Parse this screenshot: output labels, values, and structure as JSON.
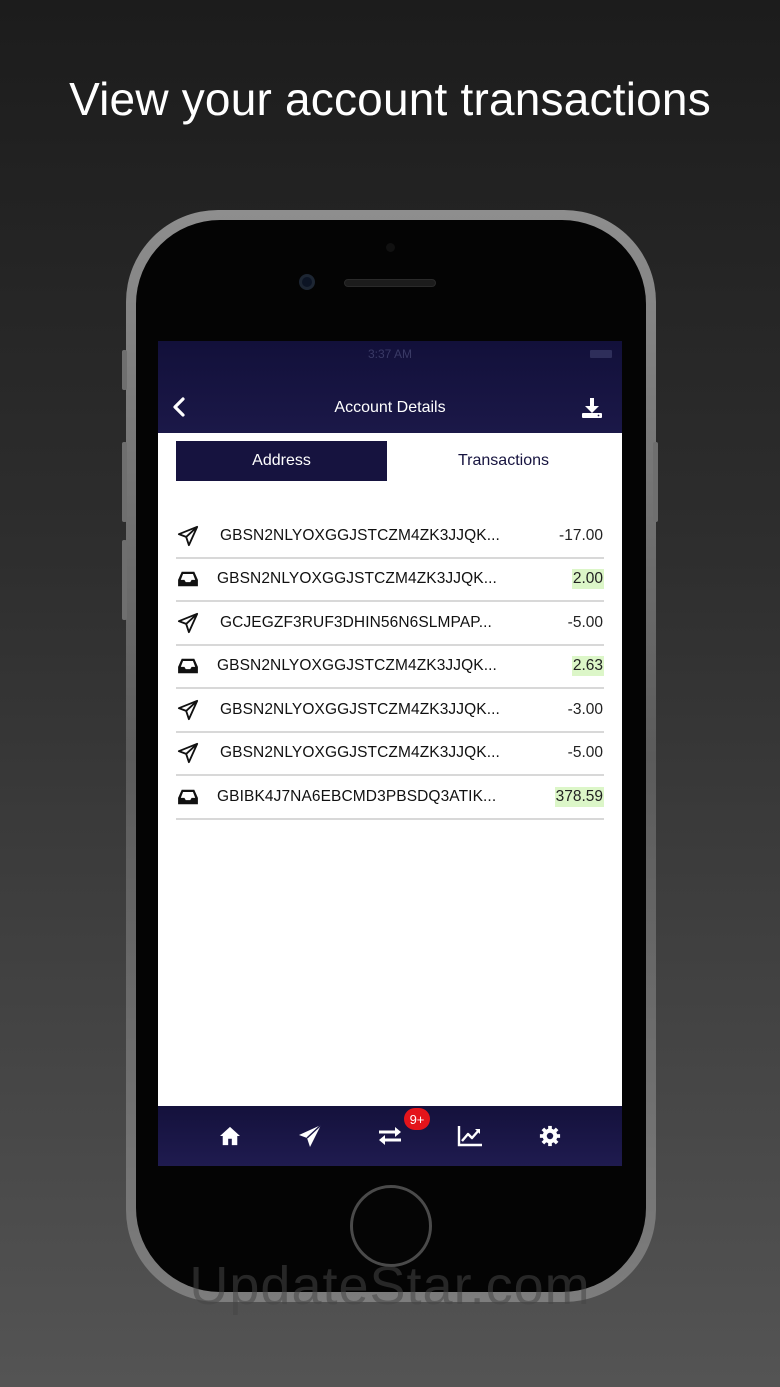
{
  "headline": "View your account transactions",
  "status": {
    "time": "3:37 AM"
  },
  "nav": {
    "title": "Account Details",
    "back_icon": "chevron-left-icon",
    "download_icon": "download-icon"
  },
  "segments": [
    {
      "label": "Address",
      "active": true
    },
    {
      "label": "Transactions",
      "active": false
    }
  ],
  "transactions": [
    {
      "type": "sent",
      "icon": "paper-plane-icon",
      "address": "GBSN2NLYOXGGJSTCZM4ZK3JJQK...",
      "amount": "-17.00"
    },
    {
      "type": "received",
      "icon": "inbox-icon",
      "address": "GBSN2NLYOXGGJSTCZM4ZK3JJQK...",
      "amount": "2.00"
    },
    {
      "type": "sent",
      "icon": "paper-plane-icon",
      "address": "GCJEGZF3RUF3DHIN56N6SLMPAP...",
      "amount": "-5.00"
    },
    {
      "type": "received",
      "icon": "inbox-icon",
      "address": "GBSN2NLYOXGGJSTCZM4ZK3JJQK...",
      "amount": "2.63"
    },
    {
      "type": "sent",
      "icon": "paper-plane-icon",
      "address": "GBSN2NLYOXGGJSTCZM4ZK3JJQK...",
      "amount": "-3.00"
    },
    {
      "type": "sent",
      "icon": "paper-plane-icon",
      "address": "GBSN2NLYOXGGJSTCZM4ZK3JJQK...",
      "amount": "-5.00"
    },
    {
      "type": "received",
      "icon": "inbox-icon",
      "address": "GBIBK4J7NA6EBCMD3PBSDQ3ATIK...",
      "amount": "378.59"
    }
  ],
  "tabbar": {
    "items": [
      "home-icon",
      "send-icon",
      "transfer-icon",
      "chart-icon",
      "settings-icon"
    ],
    "badge": "9+"
  },
  "colors": {
    "navy": "#16133f",
    "positive_bg": "#dcf6c8",
    "badge": "#e4141b"
  },
  "watermark": "UpdateStar.com"
}
